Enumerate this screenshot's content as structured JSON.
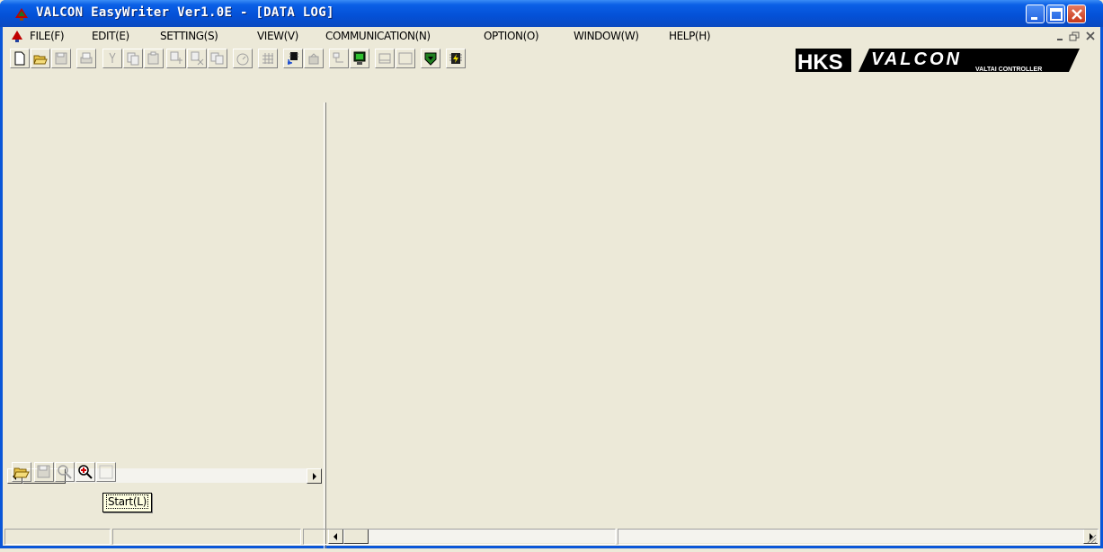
{
  "window": {
    "title": "VALCON EasyWriter Ver1.0E - [DATA LOG]"
  },
  "menu": {
    "items": [
      {
        "label": "FILE(F)"
      },
      {
        "label": "EDIT(E)"
      },
      {
        "label": "SETTING(S)"
      },
      {
        "label": "VIEW(V)"
      },
      {
        "label": "COMMUNICATION(N)"
      },
      {
        "label": "OPTION(O)"
      },
      {
        "label": "WINDOW(W)"
      },
      {
        "label": "HELP(H)"
      }
    ]
  },
  "logo": {
    "brand": "HKS",
    "product": "VALCON",
    "tagline": "VALTAI CONTROLLER"
  },
  "tooltip": {
    "label": "Start(L)"
  },
  "colors": {
    "titlebar": "#0a5fe6",
    "face": "#ece9d8",
    "close_button": "#c6381a"
  }
}
